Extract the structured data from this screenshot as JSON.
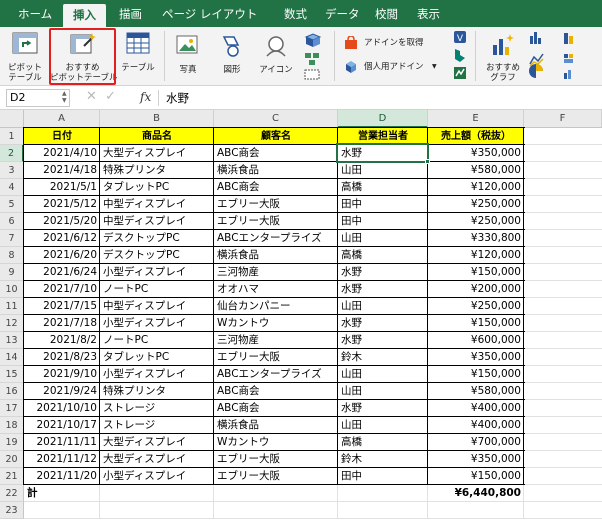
{
  "tabs": [
    {
      "label": "ホーム",
      "active": false
    },
    {
      "label": "挿入",
      "active": true
    },
    {
      "label": "描画",
      "active": false
    },
    {
      "label": "ページ レイアウト",
      "active": false
    },
    {
      "label": "数式",
      "active": false
    },
    {
      "label": "データ",
      "active": false
    },
    {
      "label": "校閲",
      "active": false
    },
    {
      "label": "表示",
      "active": false
    }
  ],
  "ribbon": {
    "pivot_line1": "ピボット",
    "pivot_line2": "テーブル",
    "rec_pivot_line1": "おすすめ",
    "rec_pivot_line2": "ピボットテーブル",
    "table": "テーブル",
    "picture": "写真",
    "shapes": "図形",
    "icons": "アイコン",
    "get_addins": "アドインを取得",
    "my_addins": "個人用アドイン",
    "rec_charts_line1": "おすすめ",
    "rec_charts_line2": "グラフ"
  },
  "formula_bar": {
    "name_box": "D2",
    "fx": "fx",
    "content": "水野"
  },
  "columns": [
    "A",
    "B",
    "C",
    "D",
    "E",
    "F"
  ],
  "selected_column": "D",
  "selected_row": 2,
  "headers": [
    "日付",
    "商品名",
    "顧客名",
    "営業担当者",
    "売上額（税抜）"
  ],
  "rows": [
    [
      "2021/4/10",
      "大型ディスプレイ",
      "ABC商会",
      "水野",
      "¥350,000"
    ],
    [
      "2021/4/18",
      "特殊プリンタ",
      "横浜食品",
      "山田",
      "¥580,000"
    ],
    [
      "2021/5/1",
      "タブレットPC",
      "ABC商会",
      "高橋",
      "¥120,000"
    ],
    [
      "2021/5/12",
      "中型ディスプレイ",
      "エブリー大阪",
      "田中",
      "¥250,000"
    ],
    [
      "2021/5/20",
      "中型ディスプレイ",
      "エブリー大阪",
      "田中",
      "¥250,000"
    ],
    [
      "2021/6/12",
      "デスクトップPC",
      "ABCエンタープライズ",
      "山田",
      "¥330,800"
    ],
    [
      "2021/6/20",
      "デスクトップPC",
      "横浜食品",
      "高橋",
      "¥120,000"
    ],
    [
      "2021/6/24",
      "小型ディスプレイ",
      "三河物産",
      "水野",
      "¥150,000"
    ],
    [
      "2021/7/10",
      "ノートPC",
      "オオハマ",
      "水野",
      "¥200,000"
    ],
    [
      "2021/7/15",
      "中型ディスプレイ",
      "仙台カンパニー",
      "山田",
      "¥250,000"
    ],
    [
      "2021/7/18",
      "小型ディスプレイ",
      "Wカントウ",
      "水野",
      "¥150,000"
    ],
    [
      "2021/8/2",
      "ノートPC",
      "三河物産",
      "水野",
      "¥600,000"
    ],
    [
      "2021/8/23",
      "タブレットPC",
      "エブリー大阪",
      "鈴木",
      "¥350,000"
    ],
    [
      "2021/9/10",
      "小型ディスプレイ",
      "ABCエンタープライズ",
      "山田",
      "¥150,000"
    ],
    [
      "2021/9/24",
      "特殊プリンタ",
      "ABC商会",
      "山田",
      "¥580,000"
    ],
    [
      "2021/10/10",
      "ストレージ",
      "ABC商会",
      "水野",
      "¥400,000"
    ],
    [
      "2021/10/17",
      "ストレージ",
      "横浜食品",
      "山田",
      "¥400,000"
    ],
    [
      "2021/11/11",
      "大型ディスプレイ",
      "Wカントウ",
      "高橋",
      "¥700,000"
    ],
    [
      "2021/11/12",
      "大型ディスプレイ",
      "エブリー大阪",
      "鈴木",
      "¥350,000"
    ],
    [
      "2021/11/20",
      "小型ディスプレイ",
      "エブリー大阪",
      "田中",
      "¥150,000"
    ]
  ],
  "total_label": "計",
  "total_value": "¥6,440,800",
  "row_numbers": [
    "1",
    "2",
    "3",
    "4",
    "5",
    "6",
    "7",
    "8",
    "9",
    "10",
    "11",
    "12",
    "13",
    "14",
    "15",
    "16",
    "17",
    "18",
    "19",
    "20",
    "21",
    "22",
    "23"
  ],
  "colors": {
    "excel_green": "#217346",
    "header_fill": "#ffff00",
    "highlight_border": "#e02020"
  }
}
